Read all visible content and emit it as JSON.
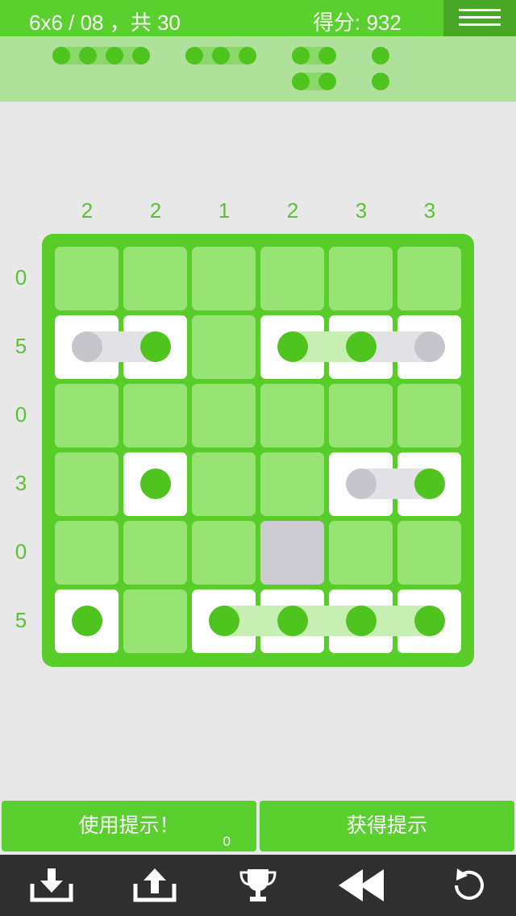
{
  "header": {
    "level_text": "6x6 / 08 ，共 30",
    "score_text": "得分: 932",
    "menu_icon": "hamburger-menu-icon"
  },
  "fleet": [
    {
      "name": "battleship",
      "length": 4,
      "count": 1
    },
    {
      "name": "cruiser",
      "length": 3,
      "count": 1
    },
    {
      "name": "destroyer",
      "length": 2,
      "count": 2
    },
    {
      "name": "submarine",
      "length": 1,
      "count": 2
    }
  ],
  "puzzle": {
    "column_clues": [
      "2",
      "2",
      "1",
      "2",
      "3",
      "3"
    ],
    "row_clues": [
      "0",
      "5",
      "0",
      "3",
      "0",
      "5"
    ],
    "grid_legend": {
      "u": "unknown",
      "w": "water",
      "s": "ship",
      "g": "ship-unconfirmed"
    },
    "grid": [
      [
        "u",
        "u",
        "u",
        "u",
        "u",
        "u"
      ],
      [
        "g",
        "s",
        "u",
        "s",
        "s",
        "g"
      ],
      [
        "u",
        "u",
        "u",
        "u",
        "u",
        "u"
      ],
      [
        "u",
        "s",
        "u",
        "u",
        "g",
        "s"
      ],
      [
        "u",
        "u",
        "u",
        "w",
        "u",
        "u"
      ],
      [
        "s",
        "u",
        "s",
        "s",
        "s",
        "s"
      ]
    ],
    "row_links": [
      {
        "row": 1,
        "from_col": 0,
        "to_col": 1
      },
      {
        "row": 1,
        "from_col": 3,
        "to_col": 5
      },
      {
        "row": 3,
        "from_col": 4,
        "to_col": 5
      },
      {
        "row": 5,
        "from_col": 2,
        "to_col": 5
      }
    ]
  },
  "actions": {
    "use_hint_label": "使用提示！",
    "hint_count": "0",
    "get_hints_label": "获得提示"
  },
  "toolbar": {
    "icons": [
      "download-icon",
      "upload-icon",
      "trophy-icon",
      "rewind-icon",
      "undo-icon"
    ]
  },
  "colors": {
    "accent": "#5ad02e",
    "accent_dark": "#48a825",
    "unknown_cell": "#97e373",
    "water_cell": "#cdccd2",
    "ship_peg": "#4fc31e",
    "toolbar_bg": "#2f2f2f"
  }
}
